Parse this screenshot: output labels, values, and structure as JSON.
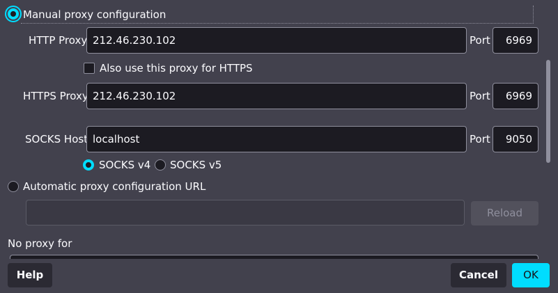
{
  "manual": {
    "label": "Manual proxy configuration",
    "http_label": "HTTP Proxy",
    "http_value": "212.46.230.102",
    "http_port_label": "Port",
    "http_port_value": "6969",
    "also_https_label": "Also use this proxy for HTTPS",
    "https_label": "HTTPS Proxy",
    "https_value": "212.46.230.102",
    "https_port_label": "Port",
    "https_port_value": "6969",
    "socks_label": "SOCKS Host",
    "socks_value": "localhost",
    "socks_port_label": "Port",
    "socks_port_value": "9050",
    "socks_v4_label": "SOCKS v4",
    "socks_v5_label": "SOCKS v5"
  },
  "auto": {
    "label": "Automatic proxy configuration URL",
    "url_value": "",
    "reload_label": "Reload"
  },
  "no_proxy": {
    "label": "No proxy for"
  },
  "footer": {
    "help_label": "Help",
    "cancel_label": "Cancel",
    "ok_label": "OK"
  },
  "colors": {
    "background": "#42414d",
    "field_bg": "#1c1b22",
    "accent": "#00ddff",
    "text": "#fbfbfe"
  }
}
